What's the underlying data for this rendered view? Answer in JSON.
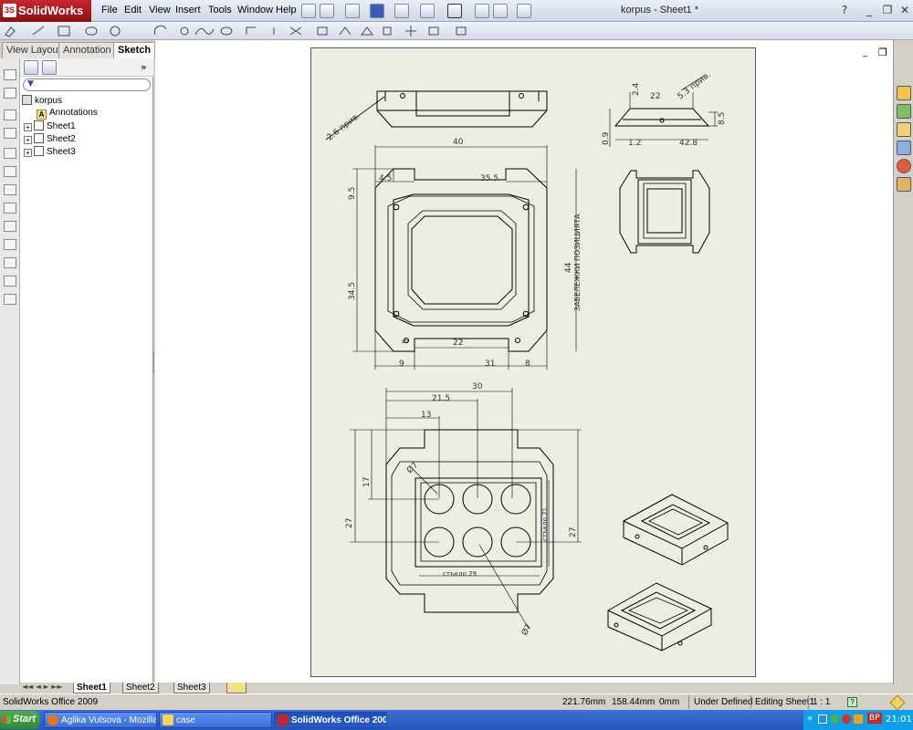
{
  "app": {
    "name": "SolidWorks",
    "document_title": "korpus - Sheet1 *"
  },
  "menu": [
    "File",
    "Edit",
    "View",
    "Insert",
    "Tools",
    "Window",
    "Help"
  ],
  "panel_tabs": [
    "View Layout",
    "Annotation",
    "Sketch"
  ],
  "tree": {
    "root": "korpus",
    "items": [
      "Annotations",
      "Sheet1",
      "Sheet2",
      "Sheet3"
    ]
  },
  "sheet_tabs": [
    "Sheet1",
    "Sheet2",
    "Sheet3"
  ],
  "drawing": {
    "dims_top": [
      "2.6 прив.",
      "40",
      "4.5",
      "35.5",
      "9.5",
      "34.5",
      "5",
      "22",
      "9",
      "31",
      "8"
    ],
    "dims_right": [
      "2.4",
      "22",
      "5.3 прив.",
      "8.5",
      "0.9",
      "1.2",
      "42.8"
    ],
    "note_vertical": "ЗАБЕЛЕЖКИ ПОЗИЦИЯТА",
    "note_44": "44",
    "dims_bottom": [
      "30",
      "21.5",
      "13",
      "17",
      "27",
      "27",
      "Ø7",
      "Ø7"
    ],
    "glass_labels": [
      "стъкло 21",
      "стъкло 29"
    ]
  },
  "status": {
    "product": "SolidWorks Office 2009",
    "x": "221.76mm",
    "y": "158.44mm",
    "z": "0mm",
    "state": "Under Defined",
    "editing": "Editing Sheet1",
    "scale": "1 : 1"
  },
  "taskbar": {
    "start": "Start",
    "tasks": [
      "Aglika Vutsova - Mozilla F...",
      "case",
      "SolidWorks Office 200..."
    ],
    "lang": "BP",
    "clock": "21:01"
  }
}
